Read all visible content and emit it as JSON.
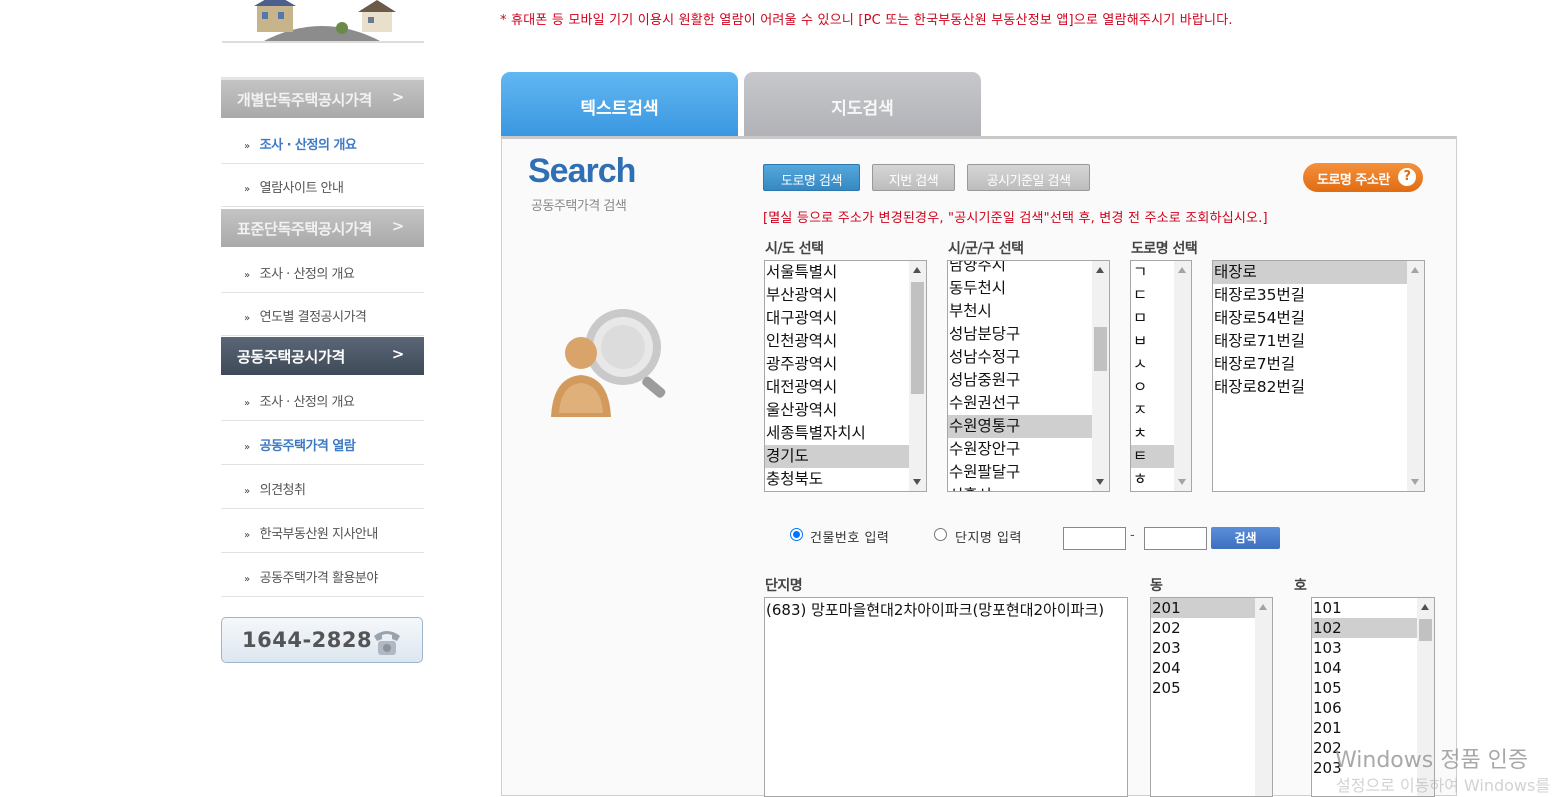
{
  "notice": "* 휴대폰 등 모바일 기기 이용시 원활한 열람이 어려울 수 있으니 [PC 또는 한국부동산원 부동산정보 앱]으로 열람해주시기 바랍니다.",
  "sidebar": {
    "sections": [
      {
        "title": "개별단독주택공시가격",
        "items": [
          "조사 · 산정의 개요",
          "열람사이트 안내"
        ]
      },
      {
        "title": "표준단독주택공시가격",
        "items": [
          "조사 · 산정의 개요",
          "연도별 결정공시가격"
        ]
      },
      {
        "title": "공동주택공시가격",
        "items": [
          "조사 · 산정의 개요",
          "공동주택가격 열람",
          "의견청취",
          "한국부동산원 지사안내",
          "공동주택가격 활용분야"
        ]
      }
    ],
    "arrow": ">",
    "bullet": "»",
    "phone": "1644-2828"
  },
  "tabs": {
    "text_search": "텍스트검색",
    "map_search": "지도검색"
  },
  "search": {
    "title": "Search",
    "subtitle": "공동주택가격 검색",
    "buttons": {
      "road": "도로명 검색",
      "lot": "지번 검색",
      "date": "공시기준일 검색"
    },
    "road_address_btn": "도로명 주소란",
    "help": "?",
    "warning": "[멸실 등으로 주소가 변경된경우, \"공시기준일 검색\"선택 후, 변경 전 주소로 조회하십시오.]",
    "sido_label": "시/도 선택",
    "sigungu_label": "시/군/구 선택",
    "road_label": "도로명 선택",
    "sido": [
      "서울특별시",
      "부산광역시",
      "대구광역시",
      "인천광역시",
      "광주광역시",
      "대전광역시",
      "울산광역시",
      "세종특별자치시",
      "경기도",
      "충청북도"
    ],
    "sigungu": [
      "남양주시",
      "동두천시",
      "부천시",
      "성남분당구",
      "성남수정구",
      "성남중원구",
      "수원권선구",
      "수원영통구",
      "수원장안구",
      "수원팔달구",
      "시흥시"
    ],
    "initials": [
      "ㄱ",
      "ㄷ",
      "ㅁ",
      "ㅂ",
      "ㅅ",
      "ㅇ",
      "ㅈ",
      "ㅊ",
      "ㅌ",
      "ㅎ"
    ],
    "roads": [
      "태장로",
      "태장로35번길",
      "태장로54번길",
      "태장로71번길",
      "태장로7번길",
      "태장로82번길"
    ],
    "radio_building": "건물번호 입력",
    "radio_complex": "단지명 입력",
    "dash": "-",
    "go": "검색",
    "complex_label": "단지명",
    "dong_label": "동",
    "ho_label": "호",
    "complex": [
      "(683) 망포마을현대2차아이파크(망포현대2아이파크)"
    ],
    "dong": [
      "201",
      "202",
      "203",
      "204",
      "205"
    ],
    "ho": [
      "101",
      "102",
      "103",
      "104",
      "105",
      "106",
      "201",
      "202",
      "203"
    ]
  },
  "watermark": {
    "line1": "Windows 정품 인증",
    "line2": "설정으로 이동하여 Windows를"
  },
  "colors": {
    "accent_blue": "#3a97e0",
    "warn_red": "#d0021b",
    "orange": "#e06c12",
    "sidebar_dark": "#3f4a58"
  },
  "selected": {
    "sido": "경기도",
    "sigungu": "수원영통구",
    "initial": "ㅌ",
    "road": "태장로",
    "dong": "201",
    "ho": "102"
  }
}
